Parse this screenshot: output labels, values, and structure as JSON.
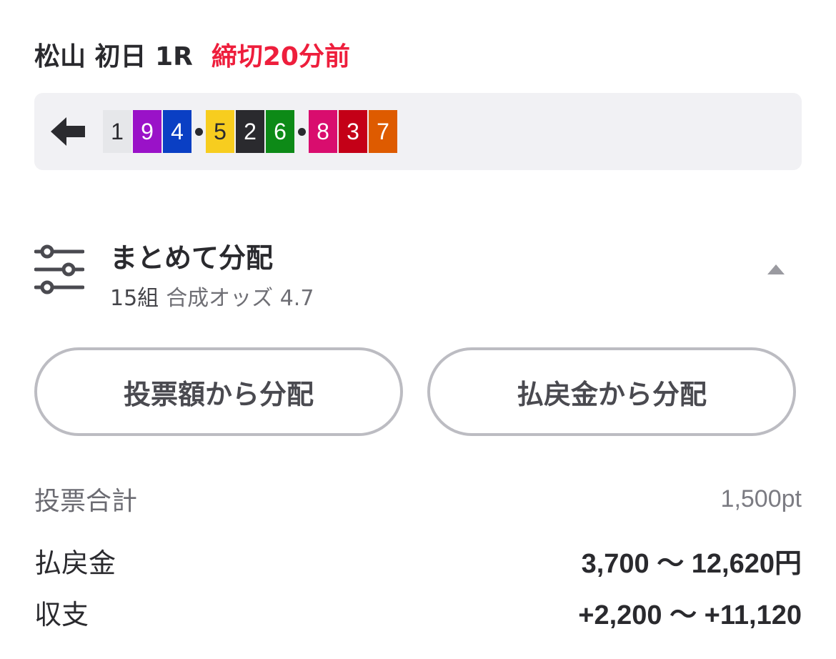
{
  "header": {
    "race": "松山 初日 1R",
    "deadline": "締切20分前"
  },
  "combination": {
    "back_icon": "arrow-left-icon",
    "groups": [
      [
        {
          "number": "1",
          "bg": "#e6e7ea",
          "fg": "#2b2b2f"
        },
        {
          "number": "9",
          "bg": "#9a12c8",
          "fg": "#ffffff"
        },
        {
          "number": "4",
          "bg": "#0a3fc4",
          "fg": "#ffffff"
        }
      ],
      [
        {
          "number": "5",
          "bg": "#f7cd1f",
          "fg": "#2b2b2f"
        },
        {
          "number": "2",
          "bg": "#2a2a2e",
          "fg": "#ffffff"
        },
        {
          "number": "6",
          "bg": "#0d8a17",
          "fg": "#ffffff"
        }
      ],
      [
        {
          "number": "8",
          "bg": "#d90d6e",
          "fg": "#ffffff"
        },
        {
          "number": "3",
          "bg": "#c40017",
          "fg": "#ffffff"
        },
        {
          "number": "7",
          "bg": "#de5b00",
          "fg": "#ffffff"
        }
      ]
    ]
  },
  "distribution": {
    "icon": "sliders-icon",
    "title": "まとめて分配",
    "count": "15組",
    "odds": "合成オッズ 4.7",
    "toggle_icon": "chevron-up-icon"
  },
  "buttons": {
    "by_bet": "投票額から分配",
    "by_payout": "払戻金から分配"
  },
  "summary": {
    "total_label": "投票合計",
    "total_value": "1,500pt",
    "payout_label": "払戻金",
    "payout_value": "3,700 〜 12,620円",
    "profit_label": "収支",
    "profit_value": "+2,200 〜 +11,120"
  },
  "colors": {
    "deadline": "#ee1e3c",
    "panel_bg": "#f1f1f4",
    "button_border": "#bcbcc2"
  }
}
